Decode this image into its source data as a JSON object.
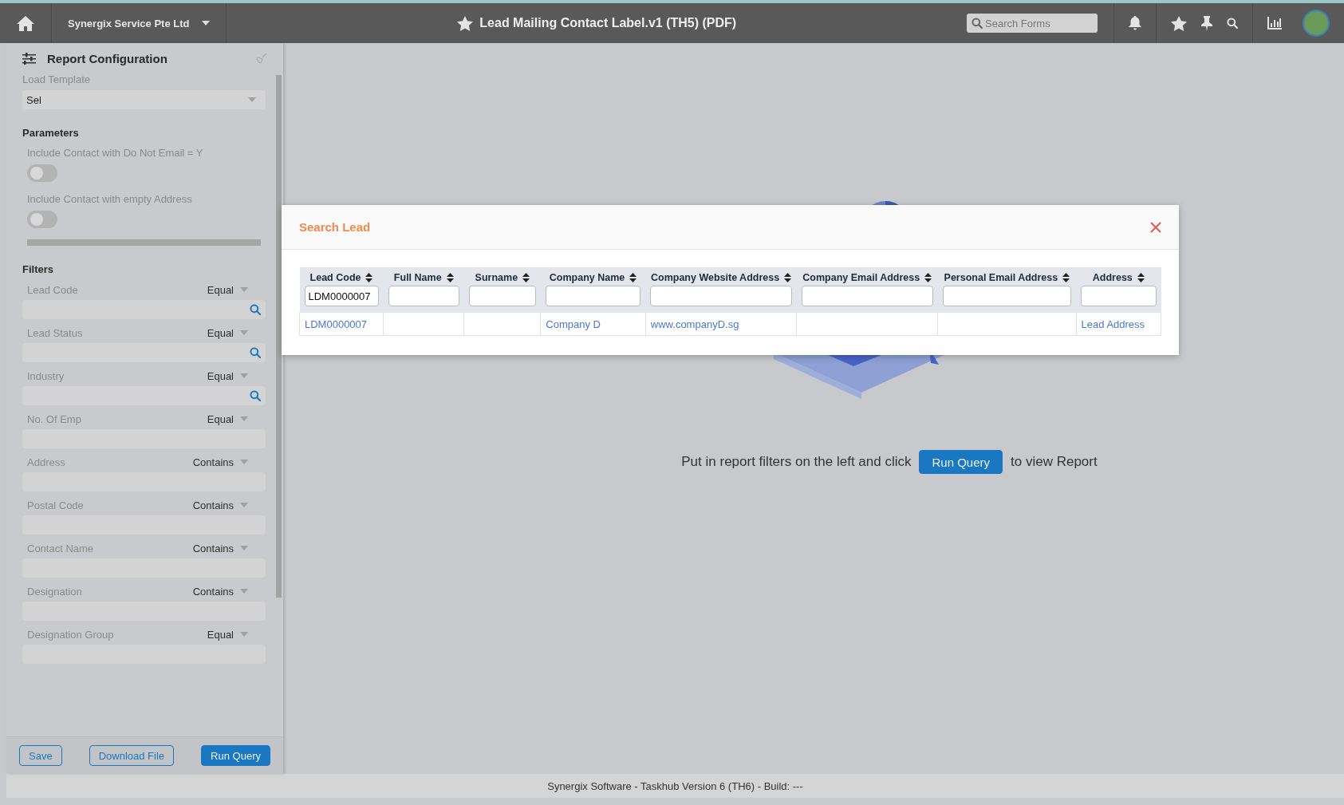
{
  "topbar": {
    "company": "Synergix Service Pte Ltd",
    "title": "Lead Mailing Contact Label.v1 (TH5) (PDF)",
    "search": {
      "placeholder": "Search Forms"
    }
  },
  "sidebar": {
    "title": "Report Configuration",
    "load_template": {
      "label": "Load Template",
      "value": "Sel"
    },
    "parameters": {
      "heading": "Parameters",
      "toggles": [
        {
          "label": "Include Contact with Do Not Email = Y",
          "on": false
        },
        {
          "label": "Include Contact with empty Address",
          "on": false
        }
      ]
    },
    "filters": {
      "heading": "Filters",
      "items": [
        {
          "label": "Lead Code",
          "operator": "Equal",
          "lookup": true
        },
        {
          "label": "Lead Status",
          "operator": "Equal",
          "lookup": true
        },
        {
          "label": "Industry",
          "operator": "Equal",
          "lookup": true
        },
        {
          "label": "No. Of Emp",
          "operator": "Equal",
          "lookup": false
        },
        {
          "label": "Address",
          "operator": "Contains",
          "lookup": false
        },
        {
          "label": "Postal Code",
          "operator": "Contains",
          "lookup": false
        },
        {
          "label": "Contact Name",
          "operator": "Contains",
          "lookup": false
        },
        {
          "label": "Designation",
          "operator": "Contains",
          "lookup": false
        },
        {
          "label": "Designation Group",
          "operator": "Equal",
          "lookup": false
        }
      ]
    },
    "buttons": [
      {
        "label": "Save",
        "kind": "outline"
      },
      {
        "label": "Download File",
        "kind": "outline"
      },
      {
        "label": "Run Query",
        "kind": "primary"
      }
    ]
  },
  "main": {
    "message_before": "Put in report filters on the left and click",
    "button": "Run Query",
    "message_after": "to view Report"
  },
  "modal": {
    "title": "Search Lead",
    "columns": [
      {
        "label": "Lead Code",
        "filter_value": "LDM0000007"
      },
      {
        "label": "Full Name"
      },
      {
        "label": "Surname"
      },
      {
        "label": "Company Name"
      },
      {
        "label": "Company Website Address"
      },
      {
        "label": "Company Email Address"
      },
      {
        "label": "Personal Email Address"
      },
      {
        "label": "Address"
      }
    ],
    "rows": [
      {
        "cells": [
          "LDM0000007",
          null,
          null,
          "Company D",
          "www.companyD.sg",
          null,
          null,
          "Lead Address"
        ]
      }
    ]
  },
  "footer": "Synergix Software - Taskhub Version 6 (TH6) - Build: ---"
}
